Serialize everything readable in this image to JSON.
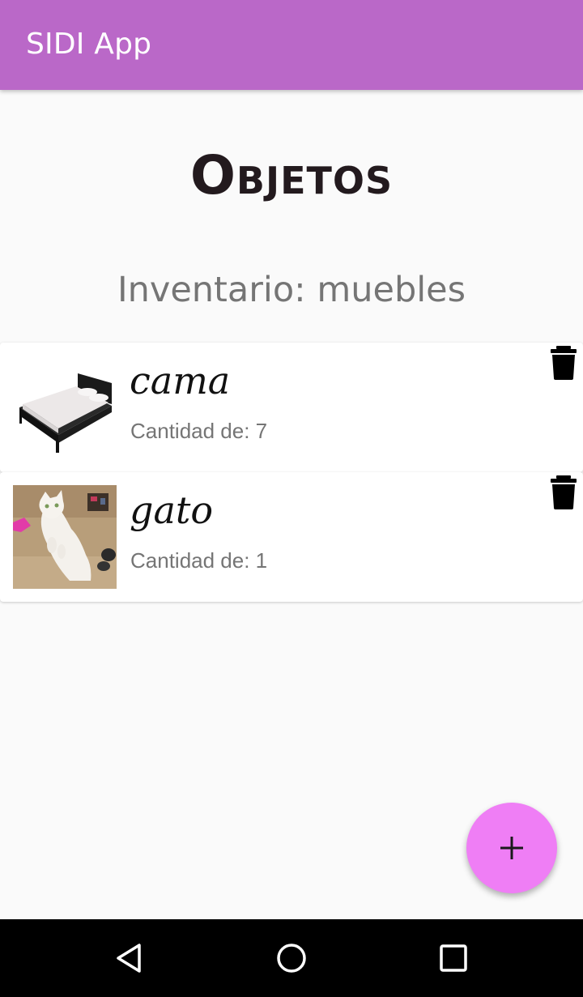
{
  "app": {
    "title": "SIDI App",
    "accent": "#ba68c8",
    "fab_color": "#ef7ef5"
  },
  "page": {
    "title": "Objetos",
    "subtitle": "Inventario: muebles"
  },
  "items": [
    {
      "name": "cama",
      "quantity_text": "Cantidad de: 7",
      "image": "bed-image",
      "delete_icon": "trash-icon"
    },
    {
      "name": "gato",
      "quantity_text": "Cantidad de: 1",
      "image": "cat-image",
      "delete_icon": "trash-icon"
    }
  ],
  "fab": {
    "icon": "plus-icon"
  },
  "navbar": {
    "icons": [
      "back-triangle-icon",
      "home-circle-icon",
      "recents-square-icon"
    ]
  }
}
